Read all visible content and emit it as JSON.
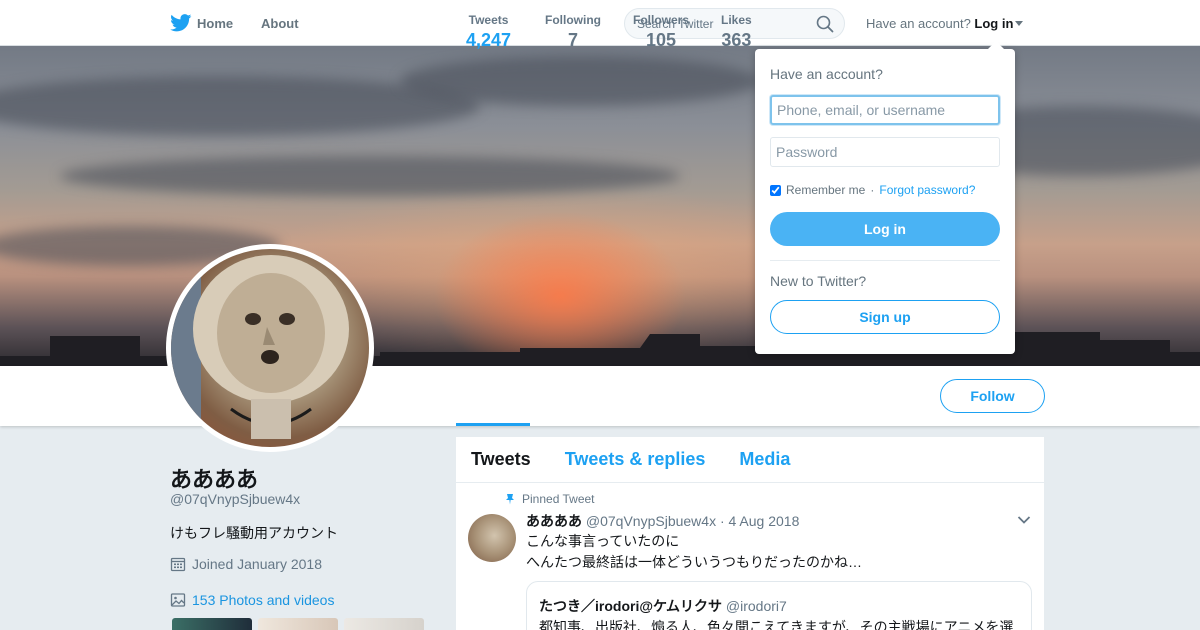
{
  "nav": {
    "home_label": "Home",
    "about_label": "About",
    "search_placeholder": "Search Twitter",
    "account_prompt": "Have an account?",
    "login_label": "Log in"
  },
  "profile": {
    "name": "ああああ",
    "handle": "@07qVnypSjbuew4x",
    "bio": "けもフレ騒動用アカウント",
    "joined": "Joined January 2018",
    "photos": "153 Photos and videos",
    "follow_label": "Follow"
  },
  "stats": [
    {
      "label": "Tweets",
      "value": "4,247"
    },
    {
      "label": "Following",
      "value": "7"
    },
    {
      "label": "Followers",
      "value": "105"
    },
    {
      "label": "Likes",
      "value": "363"
    }
  ],
  "timeline": {
    "tabs": [
      "Tweets",
      "Tweets & replies",
      "Media"
    ],
    "pinned_label": "Pinned Tweet",
    "tweet": {
      "name": "ああああ",
      "meta": "@07qVnypSjbuew4x · 4 Aug 2018",
      "line1": "こんな事言っていたのに",
      "line2": "へんたつ最終話は一体どういうつもりだったのかね…"
    },
    "quote": {
      "name": "たつき／irodori@ケムリクサ",
      "handle": "@irodori7",
      "text": "都知事、出版社、煽る人、色々聞こえてきますが、その主戦場にアニメを選"
    }
  },
  "login_dropdown": {
    "title": "Have an account?",
    "username_placeholder": "Phone, email, or username",
    "password_placeholder": "Password",
    "remember_label": "Remember me",
    "separator": "·",
    "forgot_label": "Forgot password?",
    "login_button": "Log in",
    "new_prompt": "New to Twitter?",
    "signup_button": "Sign up"
  },
  "colors": {
    "accent": "#1da1f2",
    "login_button": "#4ab3f4",
    "background": "#e6ecf0"
  }
}
